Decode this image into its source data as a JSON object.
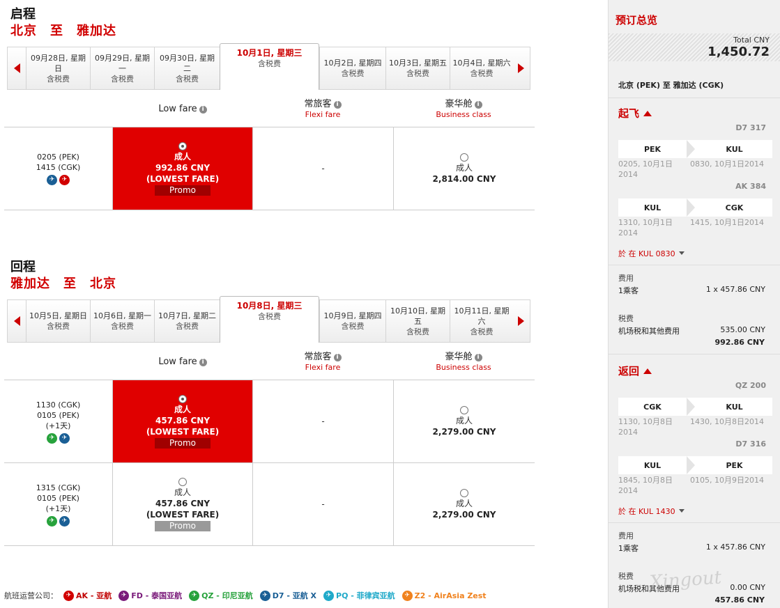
{
  "outbound": {
    "title": "启程",
    "route": "北京　至　雅加达",
    "dates": [
      {
        "d": "09月28日, 星期日",
        "t": "含税费"
      },
      {
        "d": "09月29日, 星期一",
        "t": "含税费"
      },
      {
        "d": "09月30日, 星期二",
        "t": "含税费"
      },
      {
        "d": "10月1日, 星期三",
        "t": "含税费"
      },
      {
        "d": "10月2日, 星期四",
        "t": "含税费"
      },
      {
        "d": "10月3日, 星期五",
        "t": "含税费"
      },
      {
        "d": "10月4日, 星期六",
        "t": "含税费"
      }
    ],
    "rows": [
      {
        "dep": "0205 (PEK)",
        "arr": "1415 (CGK)",
        "plus": "",
        "low": {
          "pax": "成人",
          "price": "992.86 CNY",
          "tag": "(LOWEST FARE)",
          "promo": "Promo"
        },
        "flexi": "-",
        "biz": {
          "pax": "成人",
          "price": "2,814.00 CNY"
        }
      }
    ]
  },
  "inbound": {
    "title": "回程",
    "route": "雅加达　至　北京",
    "dates": [
      {
        "d": "10月5日, 星期日",
        "t": "含税费"
      },
      {
        "d": "10月6日, 星期一",
        "t": "含税费"
      },
      {
        "d": "10月7日, 星期二",
        "t": "含税费"
      },
      {
        "d": "10月8日, 星期三",
        "t": "含税费"
      },
      {
        "d": "10月9日, 星期四",
        "t": "含税费"
      },
      {
        "d": "10月10日, 星期五",
        "t": "含税费"
      },
      {
        "d": "10月11日, 星期六",
        "t": "含税费"
      }
    ],
    "rows": [
      {
        "dep": "1130 (CGK)",
        "arr": "0105 (PEK)",
        "plus": "(+1天)",
        "low": {
          "pax": "成人",
          "price": "457.86 CNY",
          "tag": "(LOWEST FARE)",
          "promo": "Promo"
        },
        "flexi": "-",
        "biz": {
          "pax": "成人",
          "price": "2,279.00 CNY"
        }
      },
      {
        "dep": "1315 (CGK)",
        "arr": "0105 (PEK)",
        "plus": "(+1天)",
        "low": {
          "pax": "成人",
          "price": "457.86 CNY",
          "tag": "(LOWEST FARE)",
          "promo": "Promo"
        },
        "flexi": "-",
        "biz": {
          "pax": "成人",
          "price": "2,279.00 CNY"
        }
      }
    ]
  },
  "columns": {
    "low": "Low fare",
    "flexi": "常旅客",
    "flexi_sub": "Flexi fare",
    "biz": "豪华舱",
    "biz_sub": "Business class"
  },
  "legend": {
    "label": "航班运营公司：",
    "items": [
      {
        "code": "AK - 亚航",
        "color": "#c00000"
      },
      {
        "code": "FD - 泰国亚航",
        "color": "#7a1b7a"
      },
      {
        "code": "QZ - 印尼亚航",
        "color": "#27a23c"
      },
      {
        "code": "D7 - 亚航 X",
        "color": "#1a5f95"
      },
      {
        "code": "PQ - 菲律宾亚航",
        "color": "#1fa9c9"
      },
      {
        "code": "Z2 - AirAsia Zest",
        "color": "#f0821e"
      }
    ]
  },
  "summary": {
    "title": "预订总览",
    "total_label": "Total CNY",
    "total": "1,450.72",
    "route": "北京 (PEK) 至 雅加达 (CGK)",
    "depart": {
      "title": "起飞",
      "flights": [
        {
          "no": "D7 317",
          "from": "PEK",
          "to": "KUL",
          "t1": "0205, 10月1日 2014",
          "t2": "0830, 10月1日2014"
        },
        {
          "no": "AK 384",
          "from": "KUL",
          "to": "CGK",
          "t1": "1310, 10月1日 2014",
          "t2": "1415, 10月1日2014"
        }
      ],
      "stop": "於 在 KUL 0830",
      "fee_label": "费用",
      "pax": "1乘客",
      "pax_val": "1 x 457.86 CNY",
      "tax_label": "税费",
      "tax_item": "机场税和其他费用",
      "tax_val": "535.00 CNY",
      "sum": "992.86 CNY"
    },
    "return": {
      "title": "返回",
      "flights": [
        {
          "no": "QZ 200",
          "from": "CGK",
          "to": "KUL",
          "t1": "1130, 10月8日 2014",
          "t2": "1430, 10月8日2014"
        },
        {
          "no": "D7 316",
          "from": "KUL",
          "to": "PEK",
          "t1": "1845, 10月8日 2014",
          "t2": "0105, 10月9日2014"
        }
      ],
      "stop": "於 在 KUL 1430",
      "fee_label": "费用",
      "pax": "1乘客",
      "pax_val": "1 x 457.86 CNY",
      "tax_label": "税费",
      "tax_item": "机场税和其他费用",
      "tax_val": "0.00 CNY",
      "sum": "457.86 CNY"
    }
  },
  "watermark": "Xingout"
}
